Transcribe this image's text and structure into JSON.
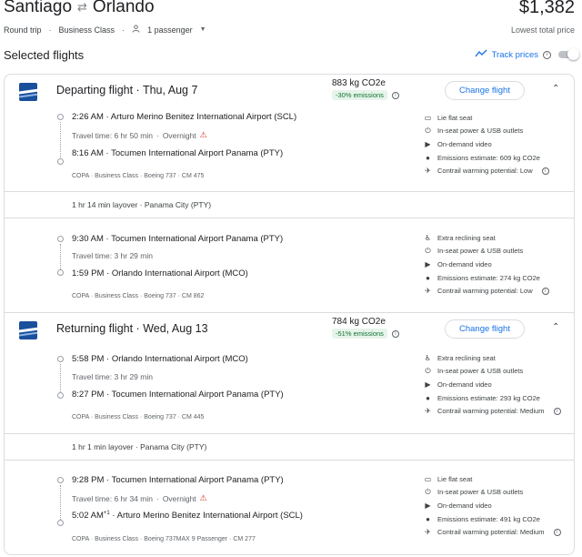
{
  "header": {
    "origin": "Santiago",
    "destination": "Orlando",
    "trip_type": "Round trip",
    "cabin": "Business Class",
    "passengers": "1 passenger",
    "price": "$1,382",
    "price_note": "Lowest total price"
  },
  "selected": {
    "title": "Selected flights",
    "track_label": "Track prices"
  },
  "departing": {
    "title": "Departing flight",
    "date": "Thu, Aug 7",
    "emissions": "883 kg CO2e",
    "emissions_pct": "-30% emissions",
    "change_label": "Change flight",
    "segments": [
      {
        "dep_time": "2:26 AM",
        "dep_airport": "Arturo Merino Benitez International Airport (SCL)",
        "travel_time": "Travel time: 6 hr 50 min",
        "overnight": "Overnight",
        "arr_time": "8:16 AM",
        "arr_airport": "Tocumen International Airport Panama (PTY)",
        "airline": "COPA",
        "cabin": "Business Class",
        "aircraft": "Boeing 737",
        "flight_no": "CM 475",
        "amenities": [
          "Lie flat seat",
          "In-seat power & USB outlets",
          "On-demand video",
          "Emissions estimate: 609 kg CO2e",
          "Contrail warming potential: Low"
        ]
      },
      {
        "dep_time": "9:30 AM",
        "dep_airport": "Tocumen International Airport Panama (PTY)",
        "travel_time": "Travel time: 3 hr 29 min",
        "arr_time": "1:59 PM",
        "arr_airport": "Orlando International Airport (MCO)",
        "airline": "COPA",
        "cabin": "Business Class",
        "aircraft": "Boeing 737",
        "flight_no": "CM 862",
        "amenities": [
          "Extra reclining seat",
          "In-seat power & USB outlets",
          "On-demand video",
          "Emissions estimate: 274 kg CO2e",
          "Contrail warming potential: Low"
        ]
      }
    ],
    "layover": "1 hr 14 min layover · Panama City (PTY)"
  },
  "returning": {
    "title": "Returning flight",
    "date": "Wed, Aug 13",
    "emissions": "784 kg CO2e",
    "emissions_pct": "-51% emissions",
    "change_label": "Change flight",
    "segments": [
      {
        "dep_time": "5:58 PM",
        "dep_airport": "Orlando International Airport (MCO)",
        "travel_time": "Travel time: 3 hr 29 min",
        "arr_time": "8:27 PM",
        "arr_airport": "Tocumen International Airport Panama (PTY)",
        "airline": "COPA",
        "cabin": "Business Class",
        "aircraft": "Boeing 737",
        "flight_no": "CM 445",
        "amenities": [
          "Extra reclining seat",
          "In-seat power & USB outlets",
          "On-demand video",
          "Emissions estimate: 293 kg CO2e",
          "Contrail warming potential: Medium"
        ]
      },
      {
        "dep_time": "9:28 PM",
        "dep_airport": "Tocumen International Airport Panama (PTY)",
        "travel_time": "Travel time: 6 hr 34 min",
        "overnight": "Overnight",
        "arr_time": "5:02 AM",
        "arr_day_offset": "+1",
        "arr_airport": "Arturo Merino Benitez International Airport (SCL)",
        "airline": "COPA",
        "cabin": "Business Class",
        "aircraft": "Boeing 737MAX 9 Passenger",
        "flight_no": "CM 277",
        "amenities": [
          "Lie flat seat",
          "In-seat power & USB outlets",
          "On-demand video",
          "Emissions estimate: 491 kg CO2e",
          "Contrail warming potential: Medium"
        ]
      }
    ],
    "layover": "1 hr 1 min layover · Panama City (PTY)"
  },
  "colors": {
    "accent": "#1a73e8",
    "emissions_bg": "#e6f4ea",
    "emissions_text": "#137333",
    "warning": "#d93025"
  }
}
